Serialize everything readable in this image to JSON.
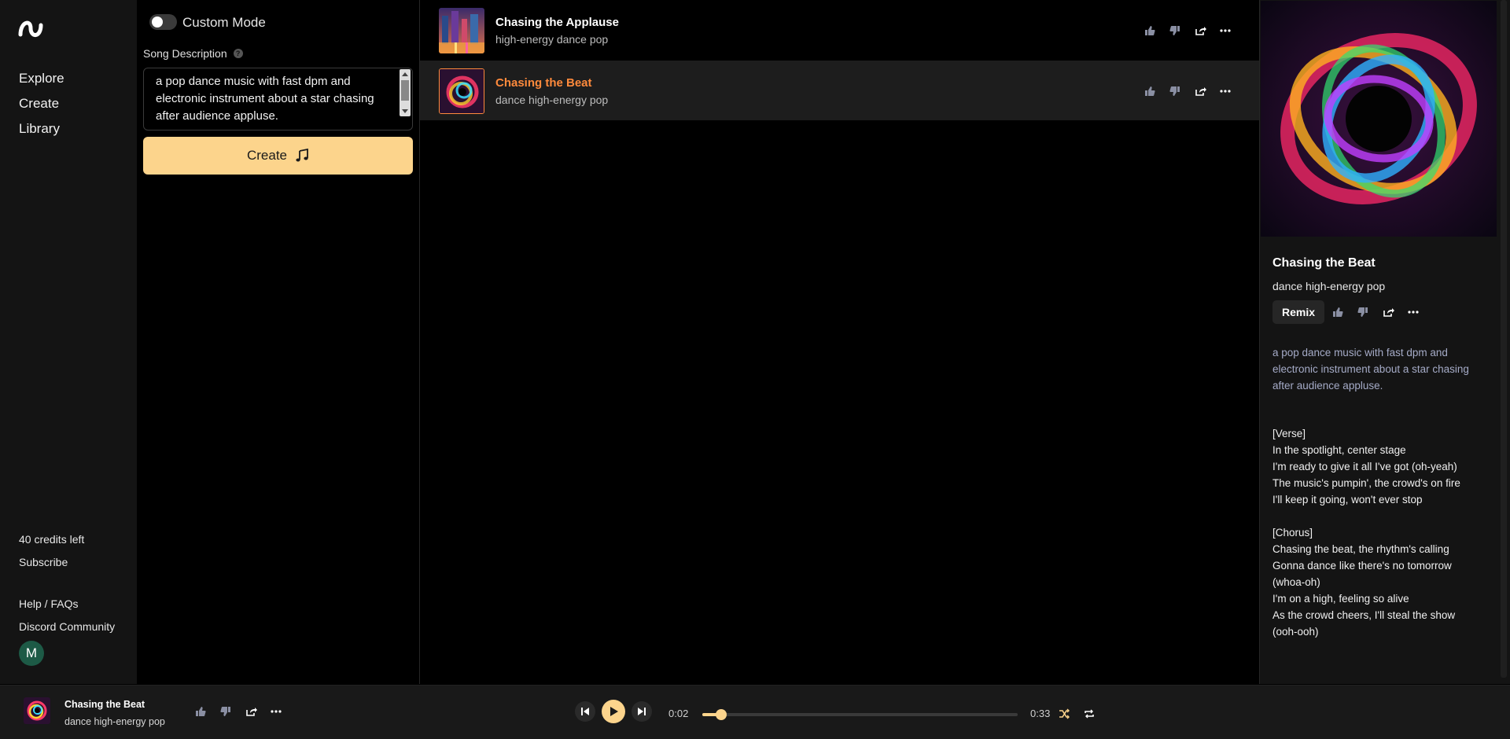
{
  "nav": {
    "items": [
      "Explore",
      "Create",
      "Library"
    ],
    "credits": "40 credits left",
    "subscribe": "Subscribe",
    "help": "Help / FAQs",
    "discord": "Discord Community",
    "avatar_initial": "M"
  },
  "create": {
    "custom_mode_label": "Custom Mode",
    "custom_mode_on": false,
    "description_label": "Song Description",
    "description_value": "a pop dance music with fast dpm and electronic instrument about a star chasing after audience appluse.",
    "create_label": "Create",
    "button_color": "#fcd48c"
  },
  "songs": [
    {
      "title": "Chasing the Applause",
      "tags": "high-energy dance pop",
      "active": false
    },
    {
      "title": "Chasing the Beat",
      "tags": "dance high-energy pop",
      "active": true
    }
  ],
  "detail": {
    "title": "Chasing the Beat",
    "tags": "dance high-energy pop",
    "remix_label": "Remix",
    "prompt": "a pop dance music with fast dpm and electronic instrument about a star chasing after audience appluse.",
    "lyrics": "[Verse]\nIn the spotlight, center stage\nI'm ready to give it all I've got (oh-yeah)\nThe music's pumpin', the crowd's on fire\nI'll keep it going, won't ever stop\n\n[Chorus]\nChasing the beat, the rhythm's calling\nGonna dance like there's no tomorrow\n(whoa-oh)\nI'm on a high, feeling so alive\nAs the crowd cheers, I'll steal the show\n(ooh-ooh)"
  },
  "player": {
    "title": "Chasing the Beat",
    "tags": "dance high-energy pop",
    "elapsed": "0:02",
    "duration": "0:33",
    "progress_fraction": 0.06
  },
  "colors": {
    "accent": "#fcd48c",
    "active_title": "#ff8a3c"
  }
}
